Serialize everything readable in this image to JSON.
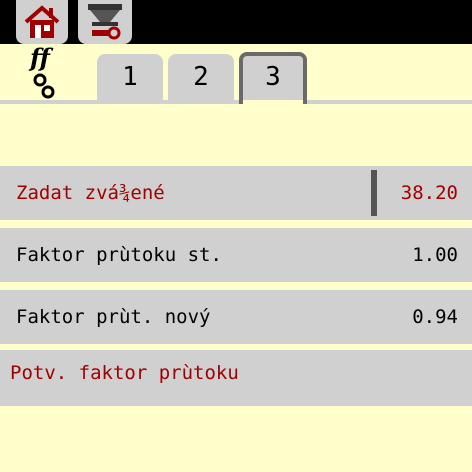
{
  "toolbar": {
    "home_icon": "home-icon",
    "settings_icon": "machine-tools-icon"
  },
  "product_icon": "flow-factor-gears-icon",
  "tabs": [
    {
      "label": "1"
    },
    {
      "label": "2"
    },
    {
      "label": "3",
      "active": true
    }
  ],
  "rows": {
    "weighed": {
      "label": "Zadat zvá¾ené",
      "value": "38.20"
    },
    "old_factor": {
      "label": "Faktor prùtoku st.",
      "value": "1.00"
    },
    "new_factor": {
      "label": "Faktor prùt. nový",
      "value": "0.94"
    },
    "confirm": {
      "label": "Potv. faktor prùtoku"
    }
  },
  "colors": {
    "background": "#ffffcc",
    "panel": "#d0d0d0",
    "accent_red": "#a00000"
  }
}
